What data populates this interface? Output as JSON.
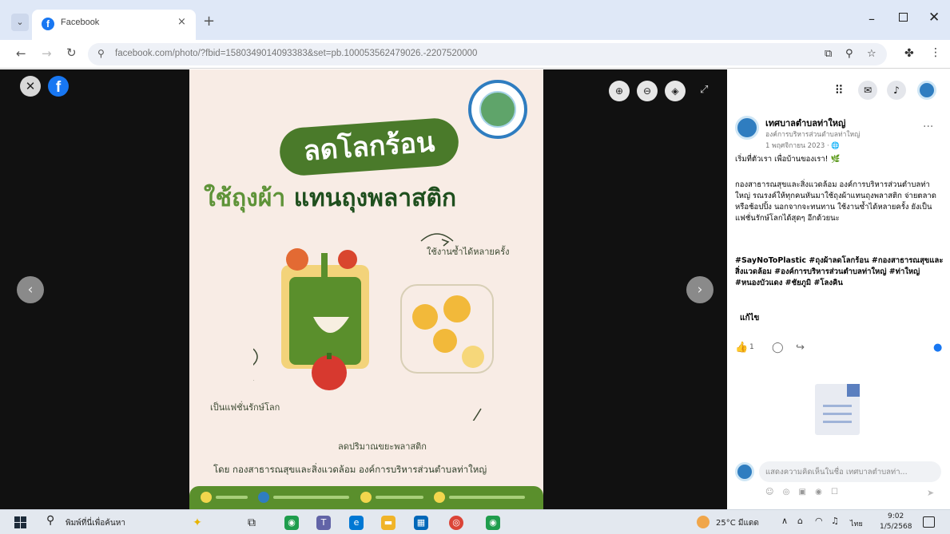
{
  "browser": {
    "tab_title": "Facebook",
    "favicon_letter": "f",
    "tab_close": "×",
    "new_tab": "+",
    "url": "facebook.com/photo/?fbid=1580349014093383&set=pb.100053562479026.-2207520000",
    "window": {
      "minimize": "–",
      "close": "✕"
    }
  },
  "viewer": {
    "close": "✕",
    "logo": "f",
    "prev": "‹",
    "next": "›",
    "tools": [
      "⊕",
      "⊖",
      "◈"
    ],
    "fullscreen": "⤢"
  },
  "poster": {
    "headline": "ลดโลกร้อน",
    "sub_green": "ใช้ถุงผ้า",
    "sub_dark": " แทนถุงพลาสติก",
    "note_reuse": "ใช้งานซ้ำได้หลายครั้ง",
    "note_eco": "เป็นแฟชั่นรักษ์โลก",
    "note_reduce": "ลดปริมาณขยะพลาสติก",
    "footer": "โดย กองสาธารณสุขและสิ่งแวดล้อม องค์การบริหารส่วนตำบลท่าใหญ่"
  },
  "panel": {
    "page_name": "เทศบาลตำบลท่าใหญ่",
    "page_sub": "องค์การบริหารส่วนตำบลท่าใหญ่",
    "post_date": "1 พฤศจิกายน 2023 · ",
    "more": "···",
    "post_line1": "เริ่มที่ตัวเรา เพื่อบ้านของเรา! 🌿",
    "post_body": "กองสาธารณสุขและสิ่งแวดล้อม องค์การบริหารส่วนตำบลท่าใหญ่ รณรงค์ให้ทุกคนหันมาใช้ถุงผ้าแทนถุงพลาสติก จ่ายตลาดหรือช้อปปิ้ง นอกจากจะทนทาน ใช้งานซ้ำได้หลายครั้ง ยังเป็นแฟชั่นรักษ์โลกได้สุดๆ อีกด้วยนะ",
    "hashtags": "#SayNoToPlastic #ถุงผ้าลดโลกร้อน #กองสาธารณสุขและสิ่งแวดล้อม #องค์การบริหารส่วนตำบลท่าใหญ่ #ท่าใหญ่ #หนองบัวแดง #ชัยภูมิ #โลงคิน",
    "edit": "แก้ไข",
    "like_count": "1",
    "comment_placeholder": "แสดงความคิดเห็นในชื่อ เทศบาลตำบลท่า...",
    "comment_tools": "☺ ◎ ▣ ◉ ☐",
    "send": "➤"
  },
  "taskbar": {
    "search_text": "พิมพ์ที่นี่เพื่อค้นหา",
    "weather": "25°C มีแดด",
    "lang": "ไทย",
    "time": "9:02",
    "date": "1/5/2568"
  },
  "colors": {
    "facebook_blue": "#1877f2",
    "poster_green": "#4a7a2a",
    "poster_bg": "#f8ece5"
  }
}
